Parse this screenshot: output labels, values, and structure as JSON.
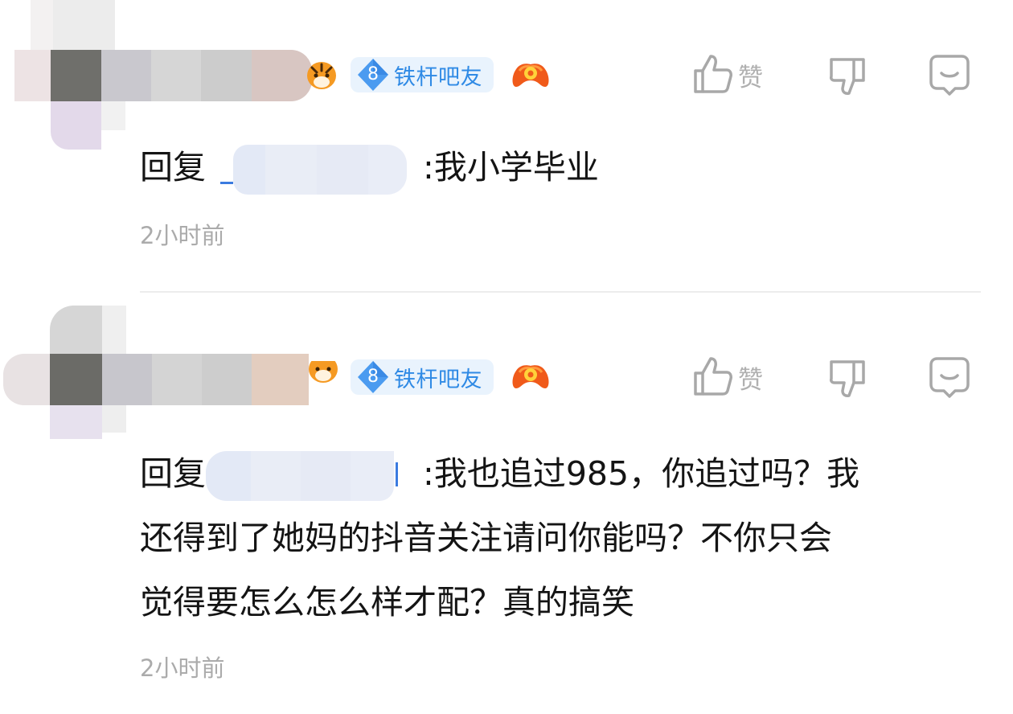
{
  "colors": {
    "badge_bg": "#e9f3fd",
    "badge_text": "#2f8ae5",
    "badge_diamond": "#4b9bf0",
    "action_icon": "#a8a8a8",
    "timestamp": "#ababab",
    "text": "#141414",
    "divider": "#ececec"
  },
  "comments": [
    {
      "username": "[redacted]",
      "level": "8",
      "level_title": "铁杆吧友",
      "badge_icon": "orange-gamepad-icon",
      "actions": {
        "like_icon": "thumbs-up-icon",
        "like_label": "赞",
        "dislike_icon": "thumbs-down-icon",
        "reply_icon": "chat-bubble-icon"
      },
      "reply_prefix": "回复",
      "reply_to": "[redacted]",
      "separator": ":",
      "text": "我小学毕业",
      "time": "2小时前"
    },
    {
      "username": "[redacted]",
      "level": "8",
      "level_title": "铁杆吧友",
      "badge_icon": "orange-gamepad-icon",
      "actions": {
        "like_icon": "thumbs-up-icon",
        "like_label": "赞",
        "dislike_icon": "thumbs-down-icon",
        "reply_icon": "chat-bubble-icon"
      },
      "reply_prefix": "回复",
      "reply_to": "[redacted]",
      "separator": ":",
      "text_lines": [
        "我也追过985，你追过吗？我",
        "还得到了她妈的抖音关注请问你能吗？不你只会",
        "觉得要怎么怎么样才配？真的搞笑"
      ],
      "time": "2小时前"
    }
  ]
}
